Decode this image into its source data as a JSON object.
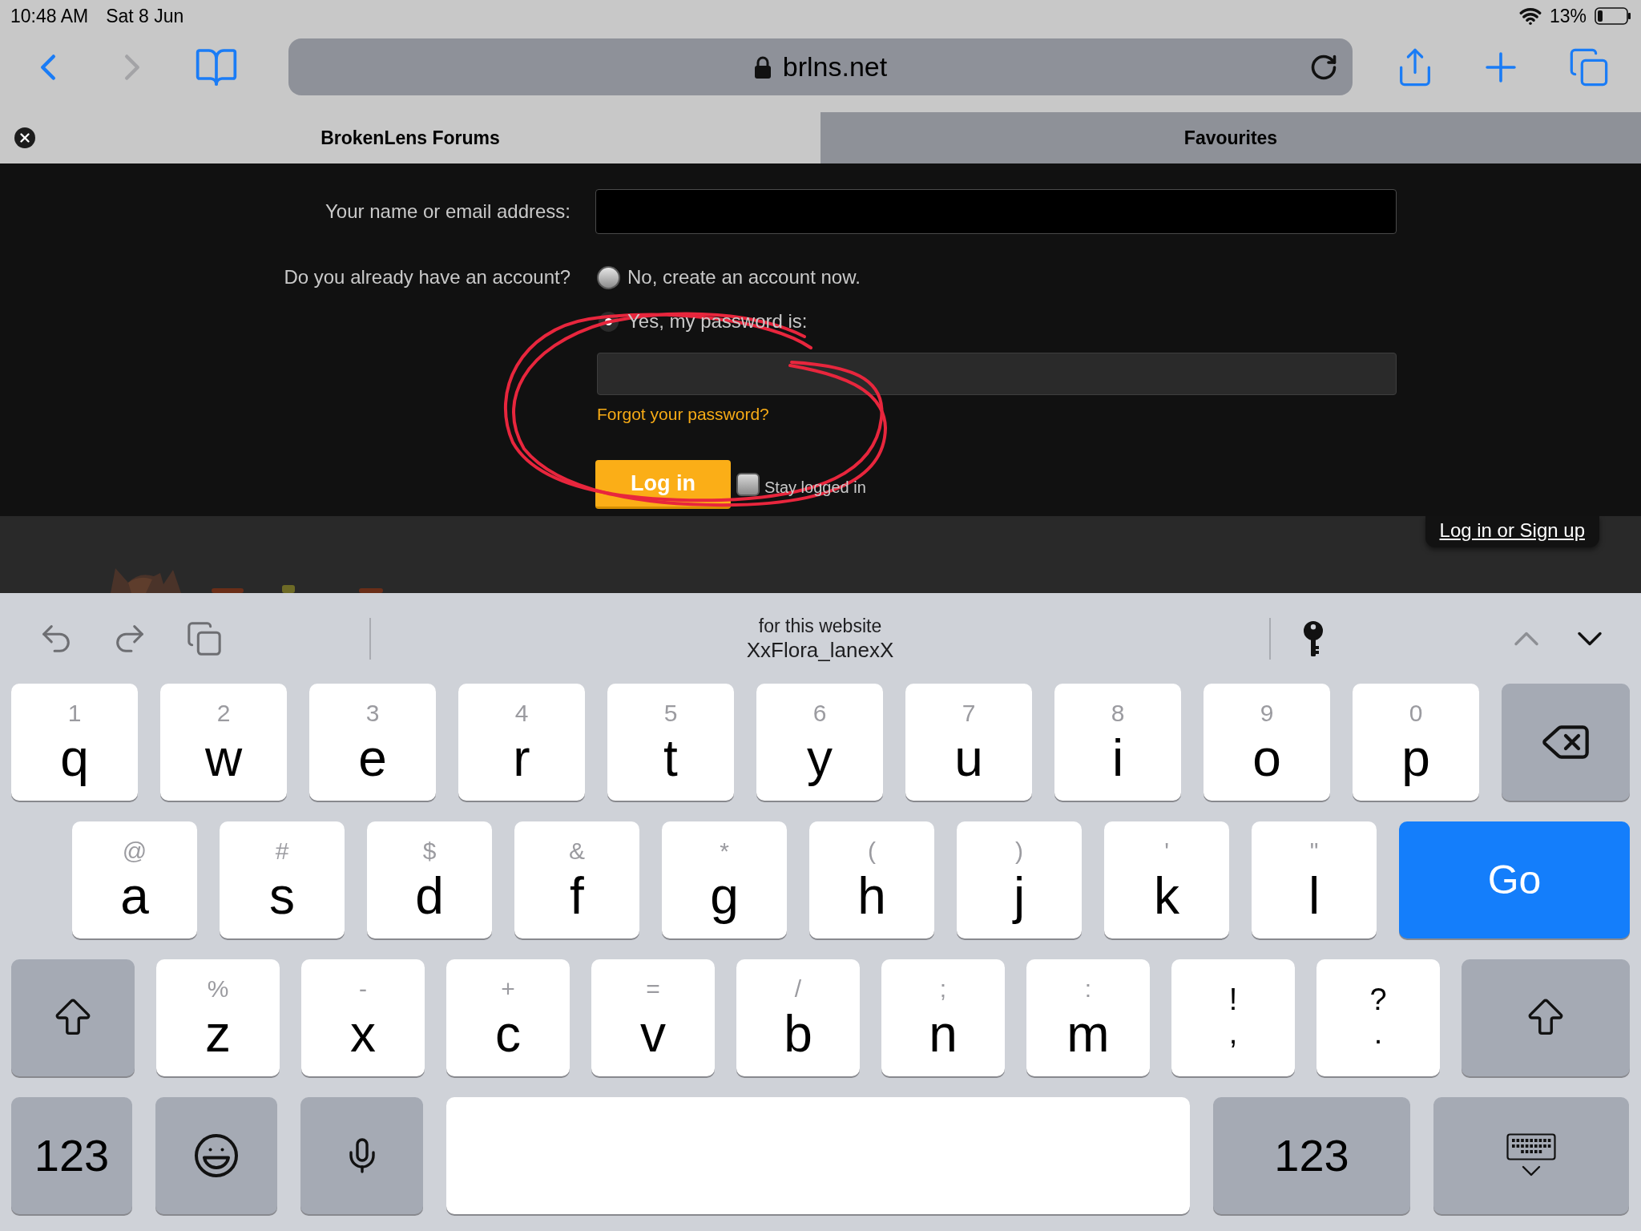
{
  "status_bar": {
    "time": "10:48 AM",
    "date": "Sat 8 Jun",
    "battery": "13%"
  },
  "toolbar": {
    "nav_buttons": [
      {
        "kind": "back",
        "disabled": false
      },
      {
        "kind": "forward",
        "disabled": true
      },
      {
        "kind": "bookmarks",
        "disabled": false
      }
    ],
    "address": "brlns.net",
    "actions": [
      {
        "kind": "share"
      },
      {
        "kind": "new_tab"
      },
      {
        "kind": "tabs"
      }
    ]
  },
  "tabs": [
    {
      "label": "BrokenLens Forums",
      "selected": true
    },
    {
      "label": "Favourites",
      "selected": false
    }
  ],
  "login_form": {
    "name_label": "Your name or email address:",
    "account_label": "Do you already have an account?",
    "account_options": [
      {
        "label": "No, create an account now.",
        "selected": false
      },
      {
        "label": "Yes, my password is:",
        "selected": true
      }
    ],
    "forgot_link": "Forgot your password?",
    "submit_button": "Log in",
    "remember": {
      "label": "Stay logged in",
      "checked": false
    }
  },
  "site_header": {
    "auth_link": "Log in or Sign up"
  },
  "keyboard": {
    "edit_buttons": [
      {
        "kind": "undo"
      },
      {
        "kind": "redo"
      },
      {
        "kind": "paste"
      }
    ],
    "suggestion": {
      "caption": "for this website",
      "value": "XxFlora_lanexX"
    },
    "field_nav": [
      {
        "kind": "previous",
        "disabled": true
      },
      {
        "kind": "next",
        "disabled": false
      }
    ],
    "rows": [
      [
        {
          "kind": "letter",
          "hint": "1",
          "label": "q"
        },
        {
          "kind": "letter",
          "hint": "2",
          "label": "w"
        },
        {
          "kind": "letter",
          "hint": "3",
          "label": "e"
        },
        {
          "kind": "letter",
          "hint": "4",
          "label": "r"
        },
        {
          "kind": "letter",
          "hint": "5",
          "label": "t"
        },
        {
          "kind": "letter",
          "hint": "6",
          "label": "y"
        },
        {
          "kind": "letter",
          "hint": "7",
          "label": "u"
        },
        {
          "kind": "letter",
          "hint": "8",
          "label": "i"
        },
        {
          "kind": "letter",
          "hint": "9",
          "label": "o"
        },
        {
          "kind": "letter",
          "hint": "0",
          "label": "p"
        },
        {
          "kind": "delete"
        }
      ],
      [
        {
          "kind": "letter",
          "hint": "@",
          "label": "a"
        },
        {
          "kind": "letter",
          "hint": "#",
          "label": "s"
        },
        {
          "kind": "letter",
          "hint": "$",
          "label": "d"
        },
        {
          "kind": "letter",
          "hint": "&",
          "label": "f"
        },
        {
          "kind": "letter",
          "hint": "*",
          "label": "g"
        },
        {
          "kind": "letter",
          "hint": "(",
          "label": "h"
        },
        {
          "kind": "letter",
          "hint": ")",
          "label": "j"
        },
        {
          "kind": "letter",
          "hint": "'",
          "label": "k"
        },
        {
          "kind": "letter",
          "hint": "\"",
          "label": "l"
        },
        {
          "kind": "go",
          "label": "Go"
        }
      ],
      [
        {
          "kind": "shift"
        },
        {
          "kind": "letter",
          "hint": "%",
          "label": "z"
        },
        {
          "kind": "letter",
          "hint": "-",
          "label": "x"
        },
        {
          "kind": "letter",
          "hint": "+",
          "label": "c"
        },
        {
          "kind": "letter",
          "hint": "=",
          "label": "v"
        },
        {
          "kind": "letter",
          "hint": "/",
          "label": "b"
        },
        {
          "kind": "letter",
          "hint": ";",
          "label": "n"
        },
        {
          "kind": "letter",
          "hint": ":",
          "label": "m"
        },
        {
          "kind": "symbol",
          "hint": "!",
          "label": ","
        },
        {
          "kind": "symbol",
          "hint": "?",
          "label": "."
        },
        {
          "kind": "shift"
        }
      ],
      [
        {
          "kind": "mode",
          "label": "123"
        },
        {
          "kind": "emoji"
        },
        {
          "kind": "dictation"
        },
        {
          "kind": "space"
        },
        {
          "kind": "mode",
          "label": "123"
        },
        {
          "kind": "hide"
        }
      ]
    ]
  }
}
